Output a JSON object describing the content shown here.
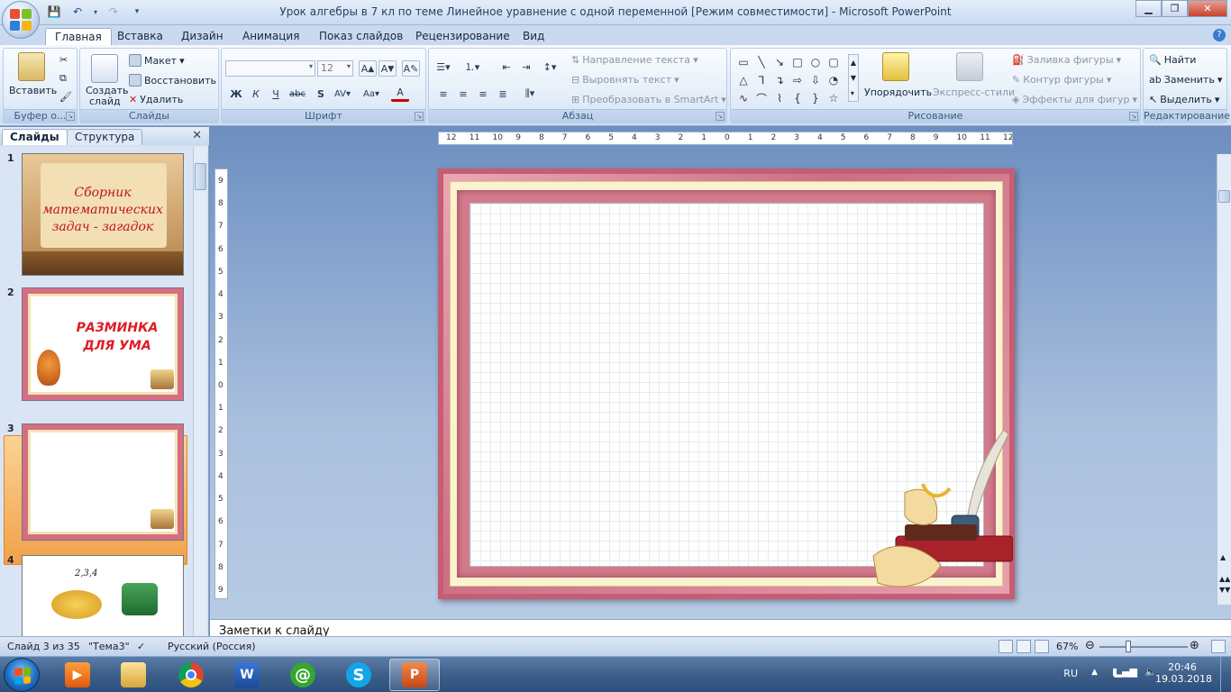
{
  "window": {
    "title": "Урок алгебры в 7 кл по теме  Линейное уравнение с одной переменной [Режим совместимости] - Microsoft PowerPoint"
  },
  "tabs": [
    "Главная",
    "Вставка",
    "Дизайн",
    "Анимация",
    "Показ слайдов",
    "Рецензирование",
    "Вид"
  ],
  "ribbon": {
    "clipboard": {
      "label": "Буфер о...",
      "paste": "Вставить"
    },
    "slides": {
      "label": "Слайды",
      "new_slide_1": "Создать",
      "new_slide_2": "слайд",
      "layout": "Макет",
      "reset": "Восстановить",
      "delete": "Удалить"
    },
    "font": {
      "label": "Шрифт",
      "font_name": "",
      "font_size": "12"
    },
    "paragraph": {
      "label": "Абзац",
      "text_direction": "Направление текста",
      "align_text": "Выровнять текст",
      "smartart": "Преобразовать в SmartArt"
    },
    "drawing": {
      "label": "Рисование",
      "arrange": "Упорядочить",
      "quick_styles": "Экспресс-стили",
      "shape_fill": "Заливка фигуры",
      "shape_outline": "Контур фигуры",
      "shape_effects": "Эффекты для фигур"
    },
    "editing": {
      "label": "Редактирование",
      "find": "Найти",
      "replace": "Заменить",
      "select": "Выделить"
    }
  },
  "panel": {
    "tab_slides": "Слайды",
    "tab_outline": "Структура",
    "thumbnails": [
      {
        "num": "1",
        "line1": "Сборник",
        "line2": "математических",
        "line3": "задач - загадок"
      },
      {
        "num": "2",
        "line1": "РАЗМИНКА",
        "line2": "ДЛЯ УМА"
      },
      {
        "num": "3"
      },
      {
        "num": "4",
        "line1": "2,3,4"
      }
    ]
  },
  "notes": {
    "placeholder": "Заметки к слайду"
  },
  "status": {
    "slide": "Слайд 3 из 35",
    "theme": "\"Тема3\"",
    "language": "Русский (Россия)",
    "zoom": "67%"
  },
  "taskbar": {
    "lang": "RU",
    "time": "20:46",
    "date": "19.03.2018",
    "apps": [
      "media-player",
      "file-explorer",
      "chrome",
      "word",
      "mail-agent",
      "skype",
      "powerpoint"
    ]
  },
  "ruler": {
    "h": [
      "12",
      "11",
      "10",
      "9",
      "8",
      "7",
      "6",
      "5",
      "4",
      "3",
      "2",
      "1",
      "0",
      "1",
      "2",
      "3",
      "4",
      "5",
      "6",
      "7",
      "8",
      "9",
      "10",
      "11",
      "12"
    ],
    "v": [
      "9",
      "8",
      "7",
      "6",
      "5",
      "4",
      "3",
      "2",
      "1",
      "0",
      "1",
      "2",
      "3",
      "4",
      "5",
      "6",
      "7",
      "8",
      "9"
    ]
  }
}
